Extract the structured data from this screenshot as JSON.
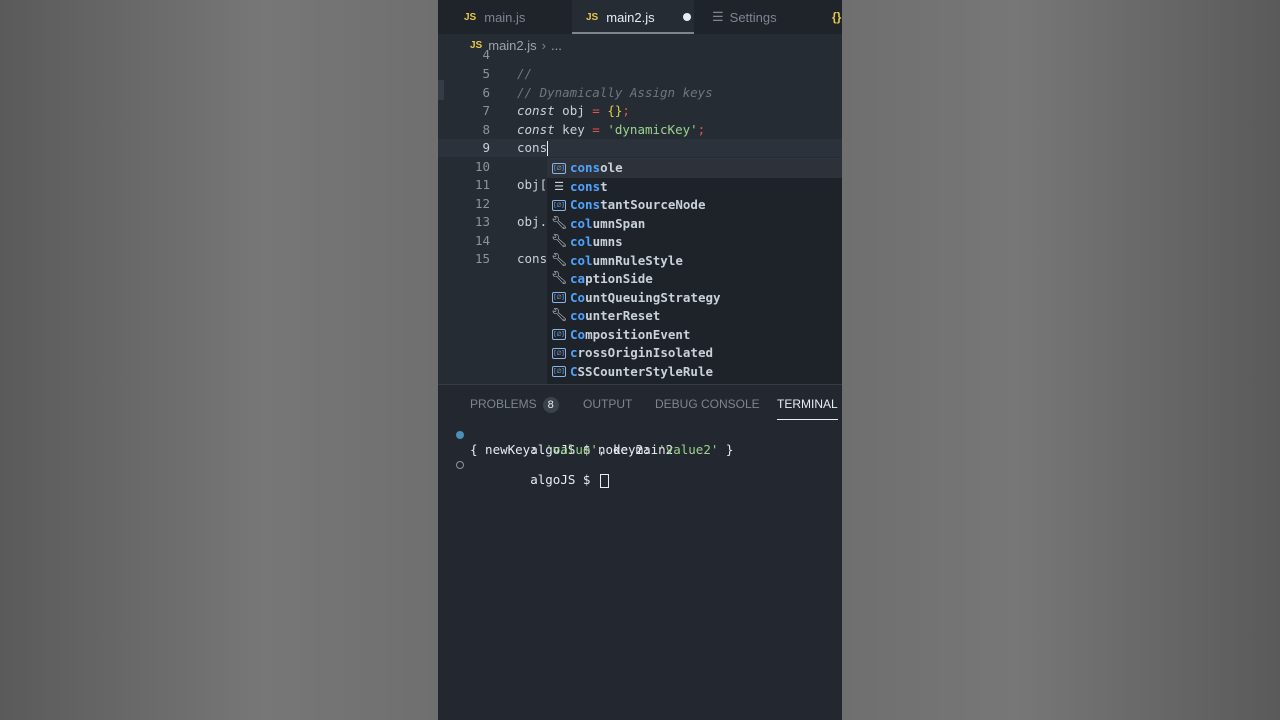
{
  "tabs": [
    {
      "badge": "JS",
      "label": "main.js",
      "active": false
    },
    {
      "badge": "JS",
      "label": "main2.js",
      "active": true,
      "dirty": true
    },
    {
      "icon": "settings-icon",
      "label": "Settings",
      "active": false
    },
    {
      "badge": "{}",
      "label": "",
      "active": false
    }
  ],
  "breadcrumb": {
    "badge": "JS",
    "file": "main2.js",
    "separator": "›",
    "more": "..."
  },
  "lines": [
    {
      "num": "4",
      "text": ""
    },
    {
      "num": "5",
      "text": "//"
    },
    {
      "num": "6",
      "text": "// Dynamically Assign keys"
    },
    {
      "num": "7",
      "kw": "const",
      "rest": " obj ",
      "op": "=",
      "brace": "{}",
      "end": ";"
    },
    {
      "num": "8",
      "kw": "const",
      "rest": " key ",
      "op": "=",
      "str": "'dynamicKey'",
      "end": ";"
    },
    {
      "num": "9",
      "text": "cons"
    },
    {
      "num": "10",
      "text": ""
    },
    {
      "num": "11",
      "text": "obj["
    },
    {
      "num": "12",
      "text": ""
    },
    {
      "num": "13",
      "text": "obj."
    },
    {
      "num": "14",
      "text": ""
    },
    {
      "num": "15",
      "text": "cons"
    }
  ],
  "suggestions": [
    {
      "match": "cons",
      "rest": "ole",
      "icon": "variable-icon"
    },
    {
      "match": "cons",
      "rest": "t",
      "icon": "keyword-icon"
    },
    {
      "match": "Cons",
      "rest": "tantSourceNode",
      "icon": "variable-icon"
    },
    {
      "match": "col",
      "rest": "umnSpan",
      "icon": "property-icon",
      "mixed": [
        "co",
        "l",
        "umnSpan"
      ]
    },
    {
      "match": "col",
      "rest": "umns",
      "icon": "property-icon"
    },
    {
      "match": "col",
      "rest": "umnRuleStyle",
      "icon": "property-icon"
    },
    {
      "match": "ca",
      "rest": "ptionSide",
      "icon": "property-icon"
    },
    {
      "match": "Co",
      "rest": "untQueuingStrategy",
      "icon": "variable-icon"
    },
    {
      "match": "co",
      "rest": "unterReset",
      "icon": "property-icon"
    },
    {
      "match": "Co",
      "rest": "mpositionEvent",
      "icon": "variable-icon"
    },
    {
      "match": "c",
      "rest": "rossOriginIsolated",
      "icon": "variable-icon"
    },
    {
      "match": "C",
      "rest": "SSCounterStyleRule",
      "icon": "variable-icon"
    }
  ],
  "suggestion_labels": [
    "console",
    "const",
    "ConstantSourceNode",
    "columnSpan",
    "columns",
    "columnRuleStyle",
    "captionSide",
    "CountQueuingStrategy",
    "counterReset",
    "CompositionEvent",
    "crossOriginIsolated",
    "CSSCounterStyleRule"
  ],
  "panel": {
    "tabs": [
      {
        "label": "PROBLEMS",
        "count": "8",
        "active": false
      },
      {
        "label": "OUTPUT",
        "active": false
      },
      {
        "label": "DEBUG CONSOLE",
        "active": false
      },
      {
        "label": "TERMINAL",
        "active": true
      }
    ],
    "terminal": {
      "line1": "algoJS $ node main2",
      "line2_pre": "{ newKey: ",
      "line2_v1": "'value'",
      "line2_mid": ", key2: ",
      "line2_v2": "'value2'",
      "line2_end": " }",
      "line3": "algoJS $ "
    }
  }
}
